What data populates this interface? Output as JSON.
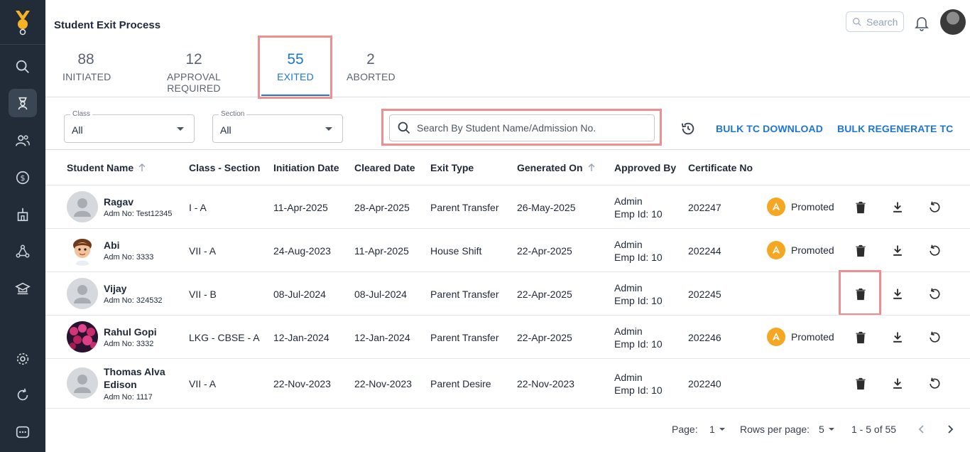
{
  "page": {
    "title": "Student Exit Process"
  },
  "header": {
    "search_placeholder": "Search"
  },
  "tabs": [
    {
      "count": "88",
      "label": "INITIATED"
    },
    {
      "count": "12",
      "label": "APPROVAL REQUIRED"
    },
    {
      "count": "55",
      "label": "EXITED",
      "active": true
    },
    {
      "count": "2",
      "label": "ABORTED"
    }
  ],
  "filters": {
    "class": {
      "label": "Class",
      "value": "All"
    },
    "section": {
      "label": "Section",
      "value": "All"
    },
    "search_placeholder": "Search By Student Name/Admission No."
  },
  "actions": {
    "bulk_tc_download": "BULK TC DOWNLOAD",
    "bulk_regenerate_tc": "BULK REGENERATE TC"
  },
  "table": {
    "headers": [
      "Student Name",
      "Class - Section",
      "Initiation Date",
      "Cleared Date",
      "Exit Type",
      "Generated On",
      "Approved By",
      "Certificate No"
    ],
    "rows": [
      {
        "name": "Ragav",
        "adm": "Adm No: Test12345",
        "class_section": "I - A",
        "initiation": "11-Apr-2025",
        "cleared": "28-Apr-2025",
        "exit_type": "Parent Transfer",
        "generated": "26-May-2025",
        "approved_name": "Admin",
        "approved_emp": "Emp Id: 10",
        "cert": "202247",
        "status": "Promoted",
        "avatar": "placeholder"
      },
      {
        "name": "Abi",
        "adm": "Adm No: 3333",
        "class_section": "VII - A",
        "initiation": "24-Aug-2023",
        "cleared": "11-Apr-2025",
        "exit_type": "House Shift",
        "generated": "22-Apr-2025",
        "approved_name": "Admin",
        "approved_emp": "Emp Id: 10",
        "cert": "202244",
        "status": "Promoted",
        "avatar": "cartoon-boy"
      },
      {
        "name": "Vijay",
        "adm": "Adm No: 324532",
        "class_section": "VII - B",
        "initiation": "08-Jul-2024",
        "cleared": "08-Jul-2024",
        "exit_type": "Parent Transfer",
        "generated": "22-Apr-2025",
        "approved_name": "Admin",
        "approved_emp": "Emp Id: 10",
        "cert": "202245",
        "status": "",
        "avatar": "placeholder"
      },
      {
        "name": "Rahul Gopi",
        "adm": "Adm No: 3332",
        "class_section": "LKG - CBSE - A",
        "initiation": "12-Jan-2024",
        "cleared": "12-Jan-2024",
        "exit_type": "Parent Transfer",
        "generated": "22-Apr-2025",
        "approved_name": "Admin",
        "approved_emp": "Emp Id: 10",
        "cert": "202246",
        "status": "Promoted",
        "avatar": "flowers"
      },
      {
        "name": "Thomas Alva Edison",
        "adm": "Adm No: 1117",
        "class_section": "VII - A",
        "initiation": "22-Nov-2023",
        "cleared": "22-Nov-2023",
        "exit_type": "Parent Desire",
        "generated": "22-Nov-2023",
        "approved_name": "Admin",
        "approved_emp": "Emp Id: 10",
        "cert": "202240",
        "status": "",
        "avatar": "placeholder"
      }
    ]
  },
  "pagination": {
    "page_label": "Page:",
    "page": "1",
    "rows_label": "Rows per page:",
    "rows": "5",
    "range": "1 - 5 of 55"
  },
  "colors": {
    "accent": "#1e76d3",
    "sidebar": "#222c38",
    "highlight": "#f08d8f",
    "promoted": "#f5a623"
  }
}
